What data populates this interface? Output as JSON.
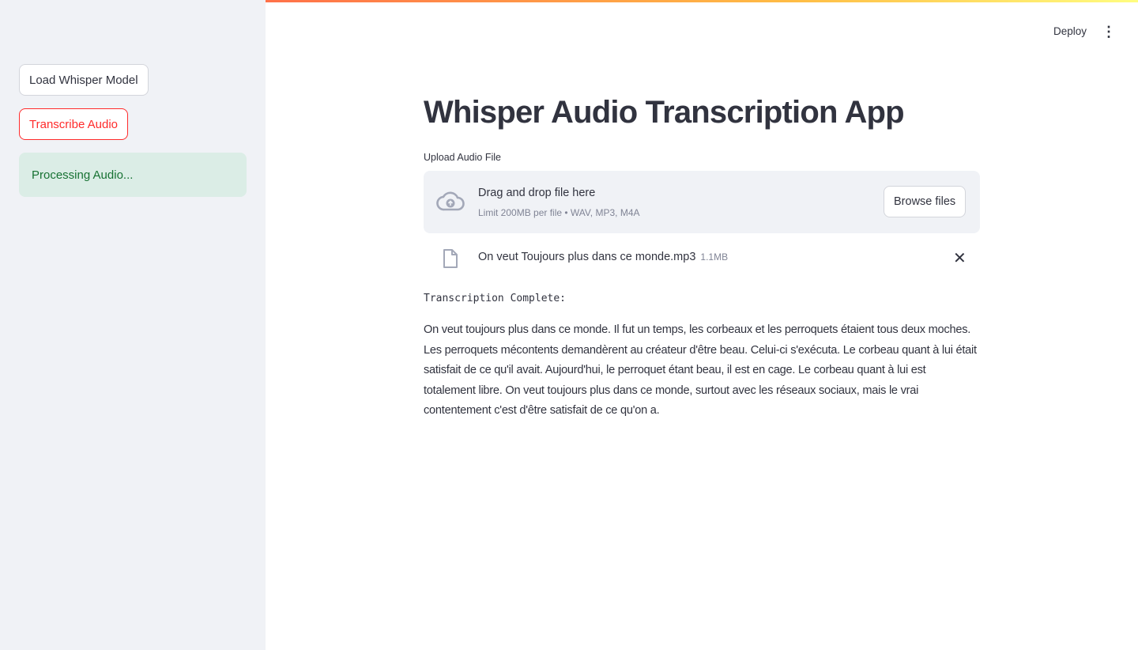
{
  "sidebar": {
    "load_button": "Load Whisper Model",
    "transcribe_button": "Transcribe Audio",
    "status": "Processing Audio..."
  },
  "header": {
    "deploy": "Deploy",
    "menu_icon": "more-vertical-icon"
  },
  "main": {
    "title": "Whisper Audio Transcription App",
    "upload_label": "Upload Audio File",
    "dropzone": {
      "title": "Drag and drop file here",
      "subtitle": "Limit 200MB per file • WAV, MP3, M4A",
      "browse": "Browse files"
    },
    "file": {
      "name": "On veut Toujours plus dans ce monde.mp3",
      "size": "1.1MB"
    },
    "result_label": "Transcription Complete:",
    "transcription": "On veut toujours plus dans ce monde. Il fut un temps, les corbeaux et les perroquets étaient tous deux moches. Les perroquets mécontents demandèrent au créateur d'être beau. Celui-ci s'exécuta. Le corbeau quant à lui était satisfait de ce qu'il avait. Aujourd'hui, le perroquet étant beau, il est en cage. Le corbeau quant à lui est totalement libre. On veut toujours plus dans ce monde, surtout avec les réseaux sociaux, mais le vrai contentement c'est d'être satisfait de ce qu'on a."
  },
  "colors": {
    "accent": "#ff2b2b",
    "status_bg": "#dbede6",
    "status_text": "#177233"
  }
}
